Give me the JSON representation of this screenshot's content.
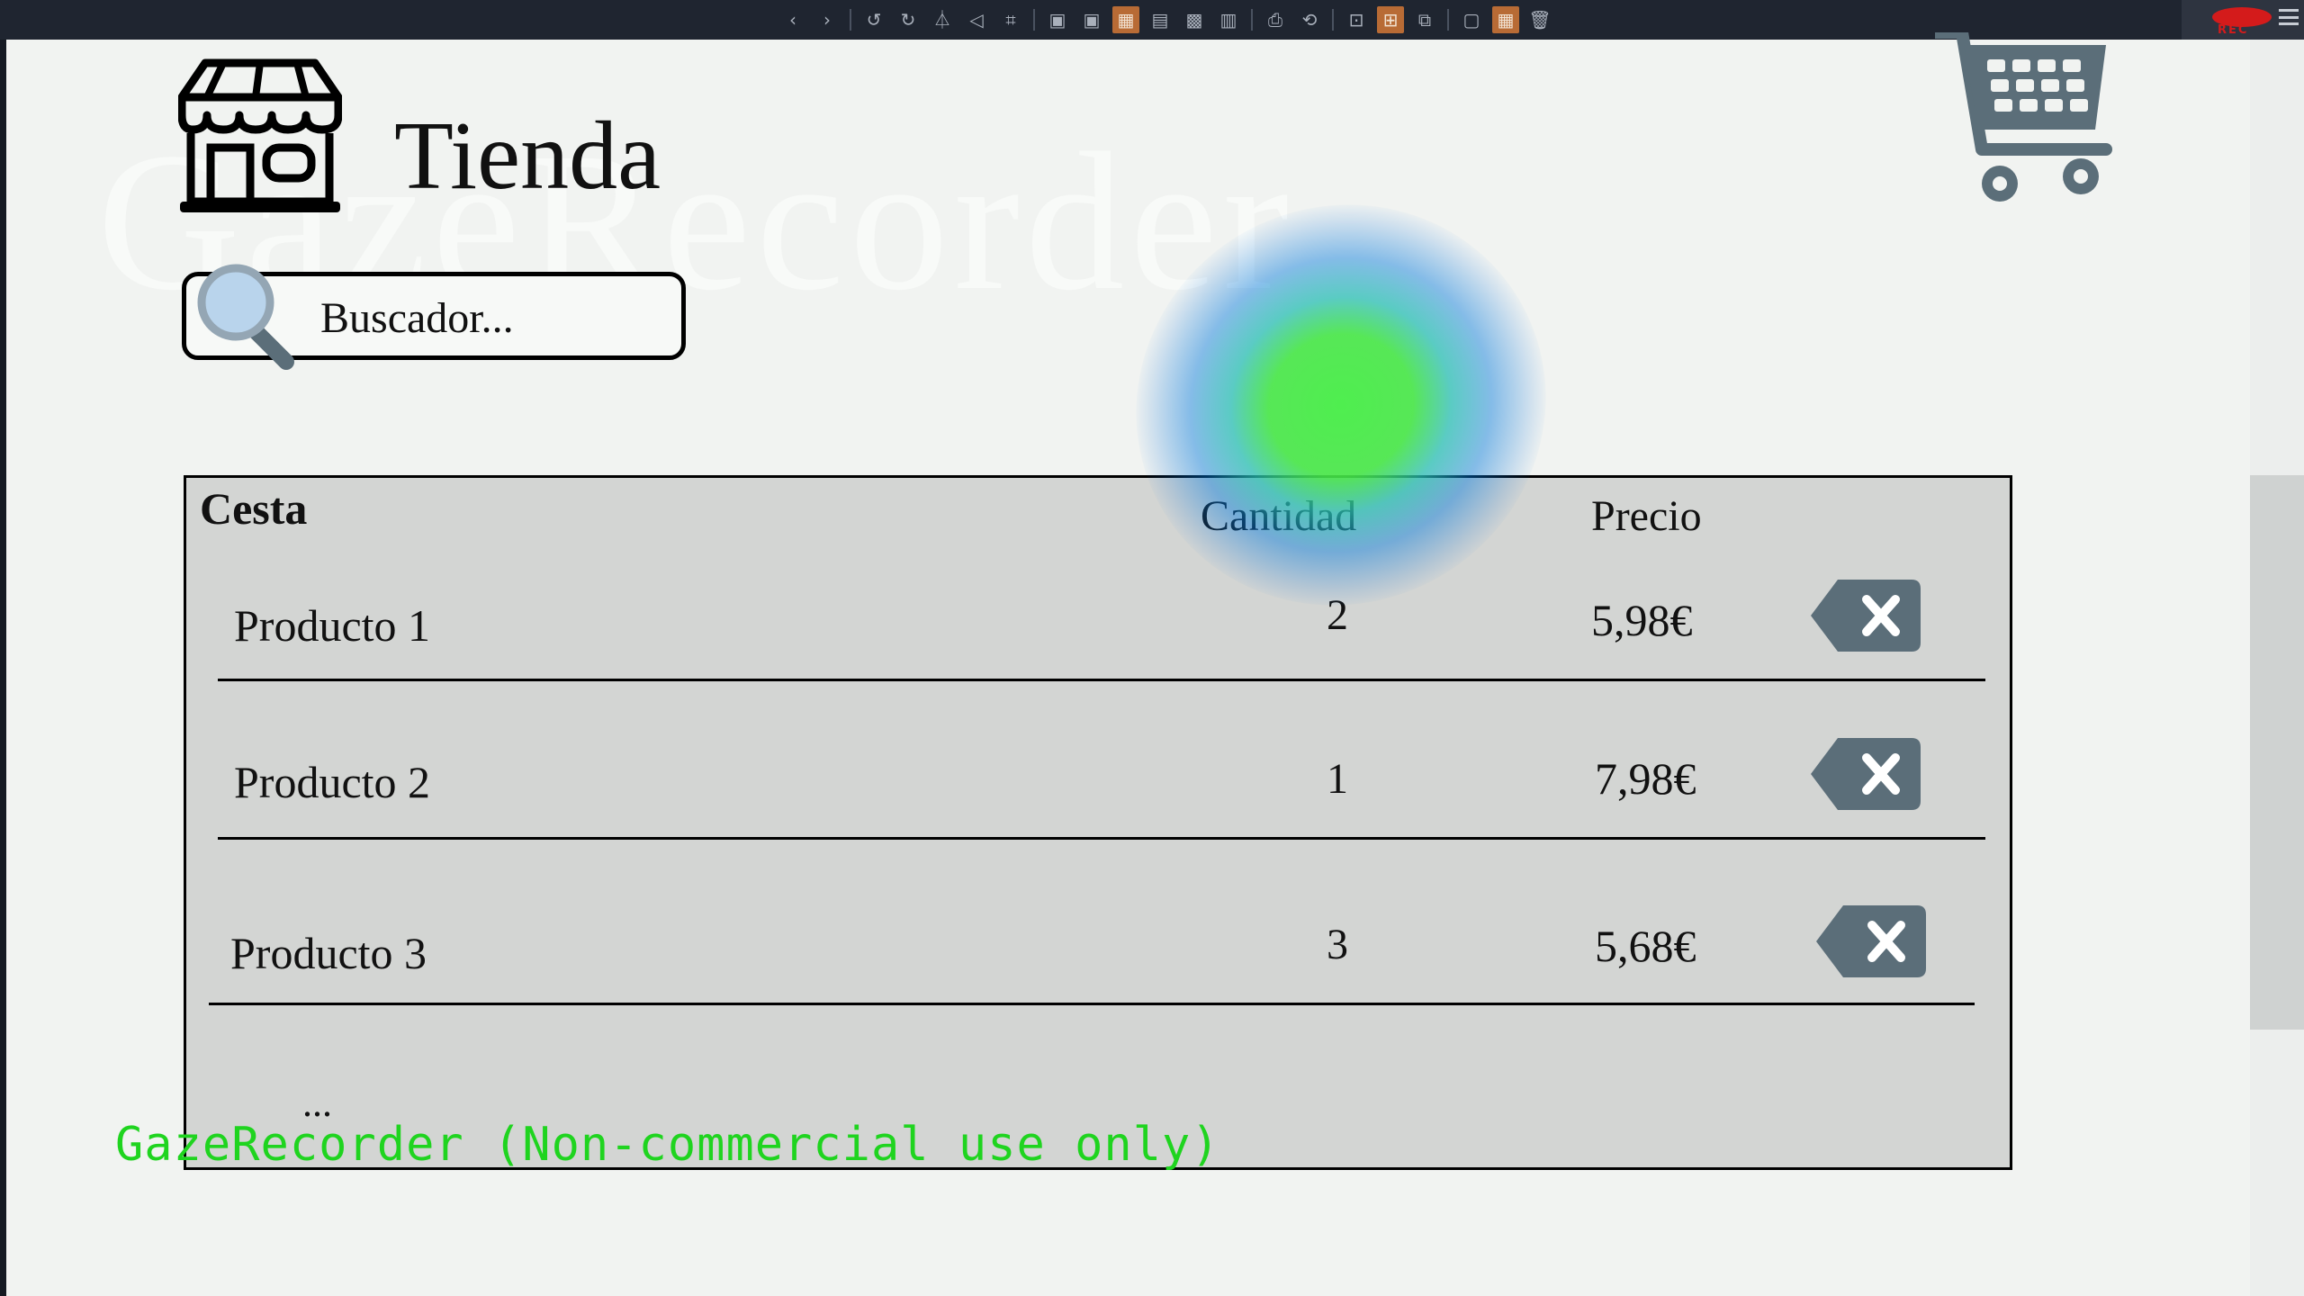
{
  "toolbar": {
    "tools": [
      {
        "icon": "back-icon",
        "glyph": "‹"
      },
      {
        "icon": "forward-icon",
        "glyph": "›"
      },
      {
        "icon": "undo-icon",
        "glyph": "↺"
      },
      {
        "icon": "redo-icon",
        "glyph": "↻"
      },
      {
        "icon": "flip-icon",
        "glyph": "⏃"
      },
      {
        "icon": "rotate-icon",
        "glyph": "◁"
      },
      {
        "icon": "crop-icon",
        "glyph": "⌗"
      },
      {
        "icon": "heatmap-icon",
        "glyph": "▣"
      },
      {
        "icon": "lock-icon",
        "glyph": "▣"
      },
      {
        "icon": "overlay-icon",
        "glyph": "▦",
        "active": true
      },
      {
        "icon": "mask-icon",
        "glyph": "▤"
      },
      {
        "icon": "blur-icon",
        "glyph": "▩"
      },
      {
        "icon": "grid-icon",
        "glyph": "▥"
      },
      {
        "icon": "print-icon",
        "glyph": "⎙"
      },
      {
        "icon": "refresh-icon",
        "glyph": "⟲"
      },
      {
        "icon": "zoom-fit-icon",
        "glyph": "⊡"
      },
      {
        "icon": "zoom-expand-icon",
        "glyph": "⊞",
        "active": true
      },
      {
        "icon": "image-edit-icon",
        "glyph": "⧉"
      },
      {
        "icon": "image-icon",
        "glyph": "▢"
      },
      {
        "icon": "tiles-icon",
        "glyph": "▦",
        "active": true
      },
      {
        "icon": "trash-icon",
        "glyph": "🗑"
      }
    ],
    "rec_label": "REC"
  },
  "watermark": "GazeRecorder",
  "header": {
    "title": "Tienda",
    "store_icon": "store-icon",
    "cart_icon": "shopping-cart-icon"
  },
  "search": {
    "placeholder": "Buscador...",
    "icon": "magnifier-icon"
  },
  "cesta": {
    "title": "Cesta",
    "columns": {
      "quantity": "Cantidad",
      "price": "Precio"
    },
    "items": [
      {
        "name": "Producto 1",
        "quantity": "2",
        "price": "5,98€"
      },
      {
        "name": "Producto 2",
        "quantity": "1",
        "price": "7,98€"
      },
      {
        "name": "Producto 3",
        "quantity": "3",
        "price": "5,68€"
      }
    ],
    "more": "...",
    "delete_icon": "delete-icon"
  },
  "overlay_note": "GazeRecorder (Non-commercial use only)",
  "colors": {
    "accent_tool": "#b86b35",
    "icon_slate": "#5b6e79",
    "gaze_green": "#46ee46",
    "note_green": "#1fd41f",
    "rec_red": "#d41b1b"
  }
}
